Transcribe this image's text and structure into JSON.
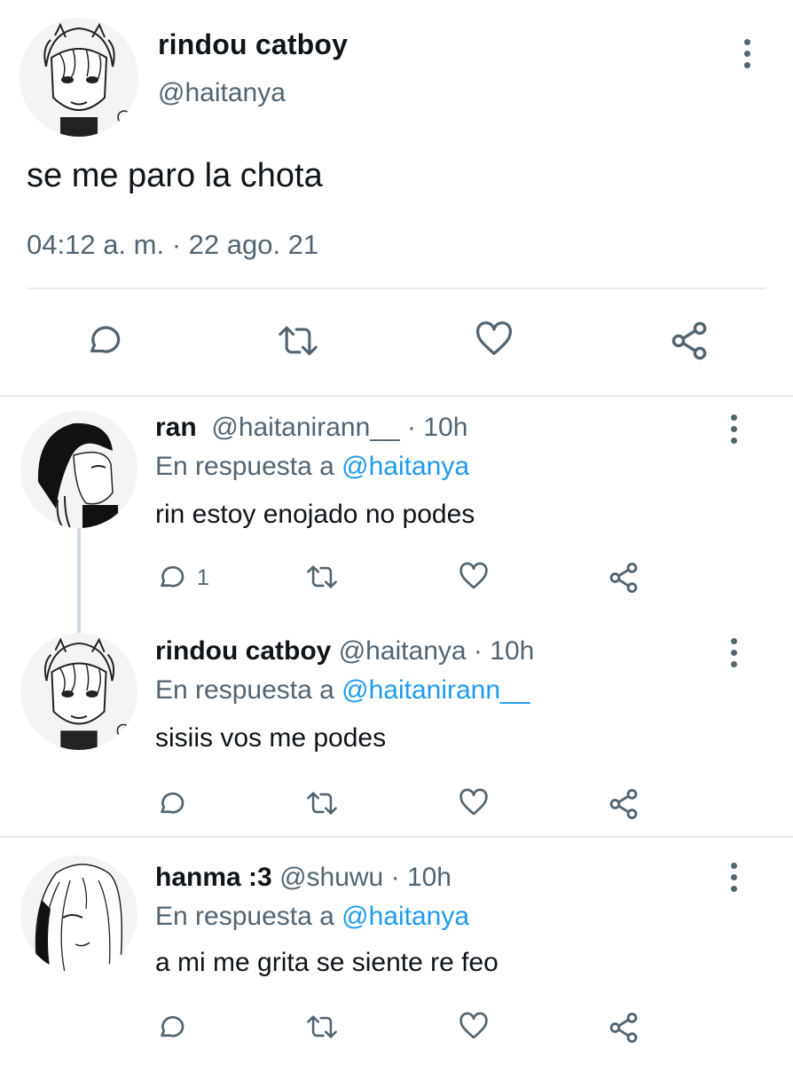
{
  "main": {
    "name": "rindou catboy",
    "handle": "@haitanya",
    "text": "se me paro la chota",
    "meta": "04:12 a. m. · 22 ago. 21",
    "icons": [
      "more-vertical-icon",
      "reply-icon",
      "retweet-icon",
      "like-icon",
      "share-icon"
    ]
  },
  "replies": [
    {
      "name": "ran",
      "handle": "@haitanirann__",
      "dot": "·",
      "time": "10h",
      "in_reply_prefix": "En respuesta a",
      "in_reply_to": "@haitanya",
      "text": "rin estoy enojado no podes",
      "reply_count": "1"
    },
    {
      "name": "rindou catboy",
      "handle": "@haitanya",
      "dot": "·",
      "time": "10h",
      "in_reply_prefix": "En respuesta a",
      "in_reply_to": "@haitanirann__",
      "text": "sisiis vos me podes",
      "reply_count": ""
    },
    {
      "name": "hanma :3",
      "handle": "@shuwu",
      "dot": "·",
      "time": "10h",
      "in_reply_prefix": "En respuesta a",
      "in_reply_to": "@haitanya",
      "text": "a mi me grita se siente re feo",
      "reply_count": ""
    }
  ],
  "colors": {
    "text": "#0f1419",
    "secondary": "#536471",
    "link": "#1d9bf0",
    "divider": "#e6ecf0"
  }
}
